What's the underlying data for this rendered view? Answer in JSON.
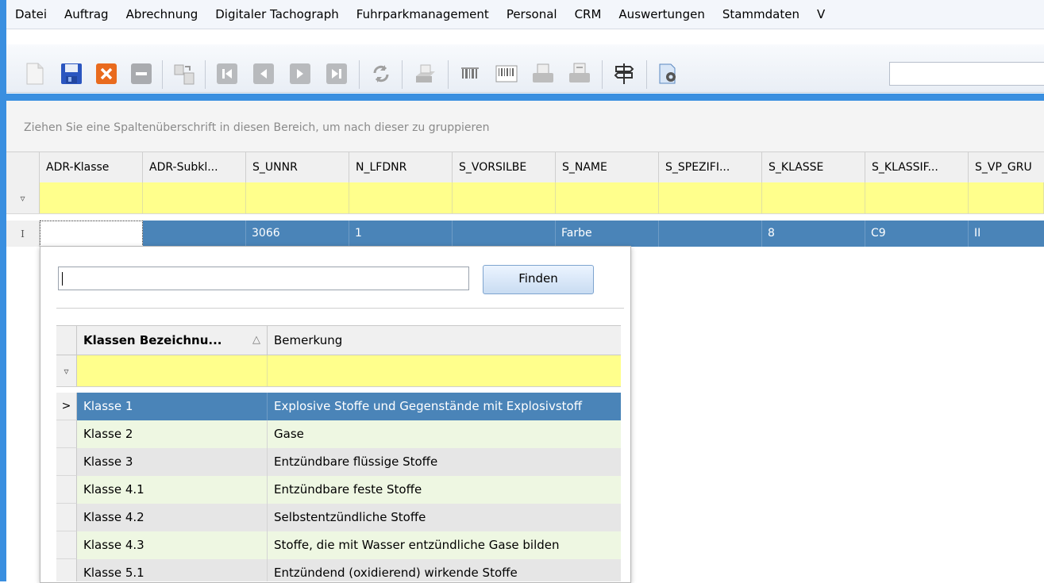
{
  "menu": [
    "Datei",
    "Auftrag",
    "Abrechnung",
    "Digitaler Tachograph",
    "Fuhrparkmanagement",
    "Personal",
    "CRM",
    "Auswertungen",
    "Stammdaten",
    "V"
  ],
  "toolbar": {
    "icons": [
      "new-doc-icon",
      "save-icon",
      "delete-icon",
      "minus-icon",
      "copy-record-icon",
      "first-icon",
      "prev-icon",
      "next-icon",
      "last-icon",
      "refresh-icon",
      "print-icon",
      "barcode-icon",
      "barcode2-icon",
      "printer2-icon",
      "printer3-icon",
      "signpost-icon",
      "settings-doc-icon"
    ],
    "search_value": ""
  },
  "grid": {
    "group_hint": "Ziehen Sie eine Spaltenüberschrift in diesen Bereich, um nach dieser zu gruppieren",
    "columns": [
      "ADR-Klasse",
      "ADR-Subkl...",
      "S_UNNR",
      "N_LFDNR",
      "S_VORSILBE",
      "S_NAME",
      "S_SPEZIFI...",
      "S_KLASSE",
      "S_KLASSIF...",
      "S_VP_GRU"
    ],
    "filter_icon": "▿",
    "row_indicator": "I",
    "row": [
      "",
      "",
      "3066",
      "1",
      "",
      "Farbe",
      "",
      "8",
      "C9",
      "II"
    ]
  },
  "popup": {
    "search_value": "",
    "find_label": "Finden",
    "columns": [
      "Klassen Bezeichnu...",
      "Bemerkung"
    ],
    "sort_glyph": "△",
    "filter_icon": "▿",
    "current_row_glyph": ">",
    "rows": [
      {
        "klasse": "Klasse 1",
        "bemerkung": "Explosive Stoffe und Gegenstände mit Explosivstoff"
      },
      {
        "klasse": "Klasse 2",
        "bemerkung": "Gase"
      },
      {
        "klasse": "Klasse 3",
        "bemerkung": "Entzündbare flüssige Stoffe"
      },
      {
        "klasse": "Klasse 4.1",
        "bemerkung": "Entzündbare feste Stoffe"
      },
      {
        "klasse": "Klasse 4.2",
        "bemerkung": "Selbstentzündliche Stoffe"
      },
      {
        "klasse": "Klasse 4.3",
        "bemerkung": "Stoffe, die mit Wasser entzündliche Gase bilden"
      },
      {
        "klasse": "Klasse 5.1",
        "bemerkung": "Entzündend (oxidierend) wirkende Stoffe"
      }
    ]
  },
  "colors": {
    "accent": "#3a8fe0",
    "selection": "#4a84b8",
    "filter_row": "#ffff8c",
    "alt_row_green": "#eef7e2",
    "alt_row_gray": "#e6e6e6"
  }
}
